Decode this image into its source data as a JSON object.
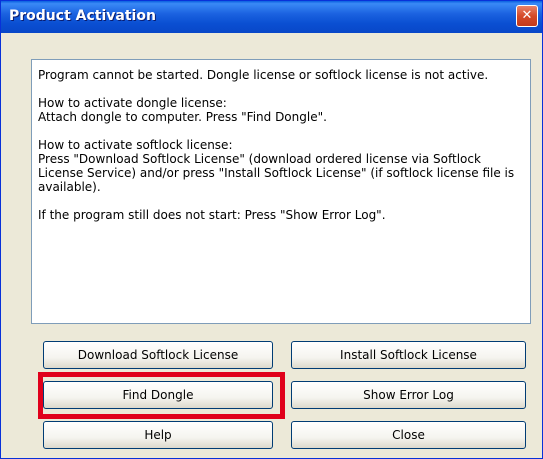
{
  "window": {
    "title": "Product Activation",
    "close_glyph": "✕"
  },
  "message": {
    "paragraphs": [
      "Program cannot be started. Dongle license or softlock license is not active.",
      "How to activate dongle license:\nAttach dongle to computer. Press \"Find Dongle\".",
      "How to activate softlock license:\nPress \"Download Softlock License\" (download ordered license via Softlock License Service) and/or press \"Install Softlock License\" (if softlock license file is available).",
      "If the program still does not start: Press \"Show Error Log\"."
    ]
  },
  "buttons": {
    "download_softlock": "Download Softlock License",
    "install_softlock": "Install Softlock License",
    "find_dongle": "Find Dongle",
    "show_error_log": "Show Error Log",
    "help": "Help",
    "close": "Close"
  },
  "annotation": {
    "highlight_color": "#e0001b",
    "highlighted_button": "Find Dongle"
  }
}
